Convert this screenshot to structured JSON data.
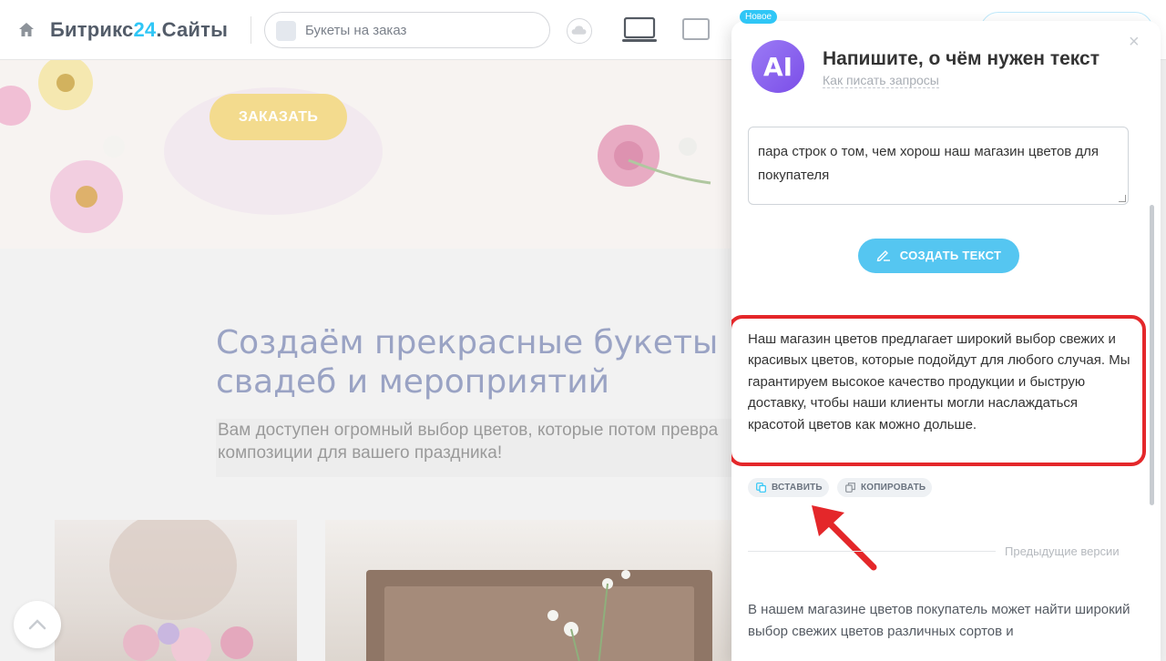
{
  "topbar": {
    "brand_prefix": "Битрикс",
    "brand_number": "24",
    "brand_suffix": ".Сайты",
    "site_name": "Букеты на заказ",
    "new_badge": "Новое",
    "icons": [
      "home-icon",
      "cloud-icon",
      "desktop-icon",
      "tablet-icon"
    ]
  },
  "page": {
    "order_button": "ЗАКАЗАТЬ",
    "heading_line1": "Создаём прекрасные букеты",
    "heading_line2": "свадеб и мероприятий",
    "sub_line1": "Вам доступен огромный выбор цветов, которые потом превра",
    "sub_line2": "композиции для вашего праздника!"
  },
  "ai_panel": {
    "logo_text": "AI",
    "title": "Напишите, о чём нужен текст",
    "help_link": "Как писать запросы",
    "close_glyph": "×",
    "prompt_value": "пара строк о том, чем хорош наш магазин цветов для покупателя",
    "create_button": "СОЗДАТЬ ТЕКСТ",
    "result_text": "Наш магазин цветов предлагает широкий выбор свежих и красивых цветов, которые подойдут для любого случая. Мы гарантируем высокое качество продукции и быструю доставку, чтобы наши клиенты могли наслаждаться красотой цветов как можно дольше.",
    "insert_button": "ВСТАВИТЬ",
    "copy_button": "КОПИРОВАТЬ",
    "previous_versions_label": "Предыдущие версии",
    "previous_text": "В нашем магазине цветов покупатель может найти широкий выбор свежих цветов различных сортов и"
  },
  "colors": {
    "accent": "#2fc6f6",
    "button_blue": "#55c6f1",
    "highlight_red": "#e4272a",
    "order_yellow": "#f3db8e",
    "ai_purple": "#8a63ef"
  }
}
